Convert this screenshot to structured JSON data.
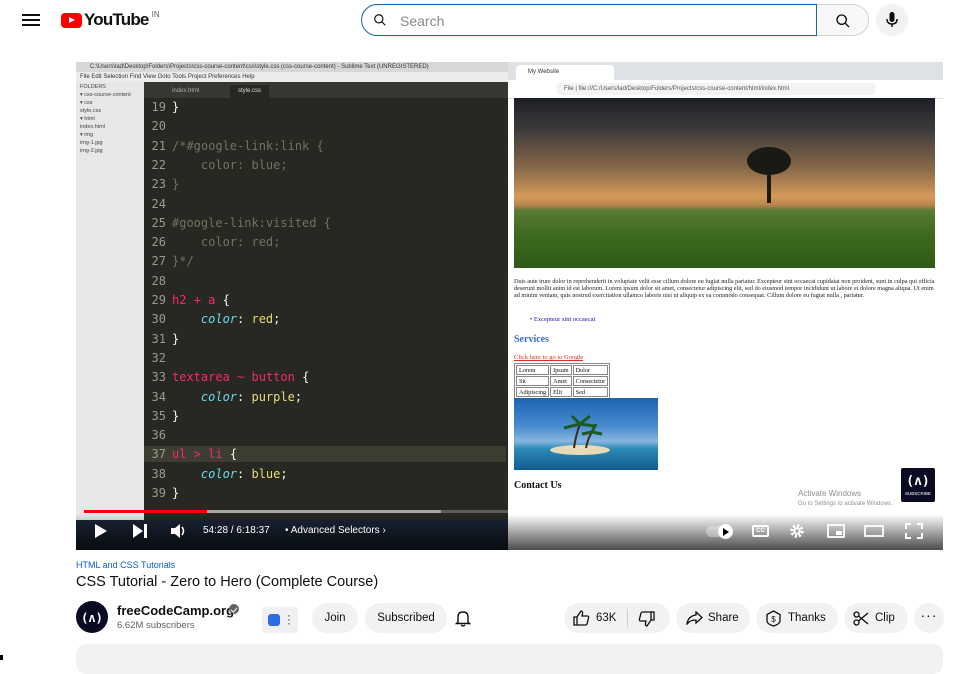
{
  "header": {
    "logo_text": "YouTube",
    "country_code": "IN",
    "search_placeholder": "Search"
  },
  "video": {
    "editor": {
      "title_bar": "C:\\Users\\lad\\Desktop\\Folders\\Projects\\css-course-content\\css\\style.css (css-course-content) - Sublime Text (UNREGISTERED)",
      "menu": "File  Edit  Selection  Find  View  Goto  Tools  Project  Preferences  Help",
      "sidebar": [
        "FOLDERS",
        "▾ css-course-content",
        "  ▾ css",
        "      style.css",
        "  ▾ html",
        "      index.html",
        "  ▾ img",
        "      img-1.jpg",
        "      img-2.jpg"
      ],
      "tabs": [
        "index.html",
        "style.css"
      ],
      "lines": [
        {
          "n": "19",
          "t": "}"
        },
        {
          "n": "20",
          "t": ""
        },
        {
          "n": "21",
          "t": "/*#google-link:link {"
        },
        {
          "n": "22",
          "t": "    color: blue;"
        },
        {
          "n": "23",
          "t": "}"
        },
        {
          "n": "24",
          "t": ""
        },
        {
          "n": "25",
          "t": "#google-link:visited {"
        },
        {
          "n": "26",
          "t": "    color: red;"
        },
        {
          "n": "27",
          "t": "}*/"
        },
        {
          "n": "28",
          "t": ""
        },
        {
          "n": "29",
          "t": "h2 + a {"
        },
        {
          "n": "30",
          "t": "    color: red;"
        },
        {
          "n": "31",
          "t": "}"
        },
        {
          "n": "32",
          "t": ""
        },
        {
          "n": "33",
          "t": "textarea ~ button {"
        },
        {
          "n": "34",
          "t": "    color: purple;"
        },
        {
          "n": "35",
          "t": "}"
        },
        {
          "n": "36",
          "t": ""
        },
        {
          "n": "37",
          "t": "ul > li {"
        },
        {
          "n": "38",
          "t": "    color: blue;"
        },
        {
          "n": "39",
          "t": "}"
        }
      ]
    },
    "browser": {
      "tab_title": "My Website",
      "url": "File | file:///C:/Users/lad/Desktop/Folders/Projects/css-course-content/html/index.html",
      "paragraph": "Duis aute irure dolor in reprehenderit in voluptate velit esse cillum dolore eu fugiat nulla pariatur. Excepteur sint occaecat cupidatat non proident, sunt in culpa qui officia deserunt mollit anim id est laborum. Lorem ipsum dolor sit amet, consectetur adipiscing elit, sed do eiusmod tempor incididunt ut labore et dolore magna aliqua. Ut enim ad minim veniam, quis nostrud exercitation ullamco laboris nisi ut aliquip ex ea commodo consequat. Cillum dolore eu fugiat nulla , pariatur.",
      "list_item": "Excepteur sint occaecat",
      "services_heading": "Services",
      "google_link": "Click here to go to Google",
      "table": [
        [
          "Lorem",
          "Ipsum",
          "Dolor"
        ],
        [
          "Sit",
          "Amet",
          "Consectetur"
        ],
        [
          "Adipiscing",
          "Elit",
          "Sed"
        ]
      ],
      "contact_heading": "Contact Us",
      "activate_title": "Activate Windows",
      "activate_sub": "Go to Settings to activate Windows.",
      "fcc_badge": "SUBSCRIBE"
    },
    "player": {
      "current_time": "54:28",
      "duration": "6:18:37",
      "time_display": "54:28 / 6:18:37",
      "chapter": "• Advanced Selectors",
      "progress_fraction": 0.144,
      "buffered_fraction": 0.42,
      "autoplay": true,
      "cc_label": "CC"
    }
  },
  "meta": {
    "category": "HTML and CSS Tutorials",
    "title": "CSS Tutorial - Zero to Hero (Complete Course)",
    "channel_name": "freeCodeCamp.org",
    "subscribers": "6.62M subscribers",
    "join_label": "Join",
    "subscribed_label": "Subscribed",
    "likes": "63K",
    "share_label": "Share",
    "thanks_label": "Thanks",
    "clip_label": "Clip"
  },
  "colors": {
    "brand_red": "#ff0000",
    "link_blue": "#065fd4",
    "editor_bg": "#272822",
    "search_border": "#1c62b9"
  }
}
